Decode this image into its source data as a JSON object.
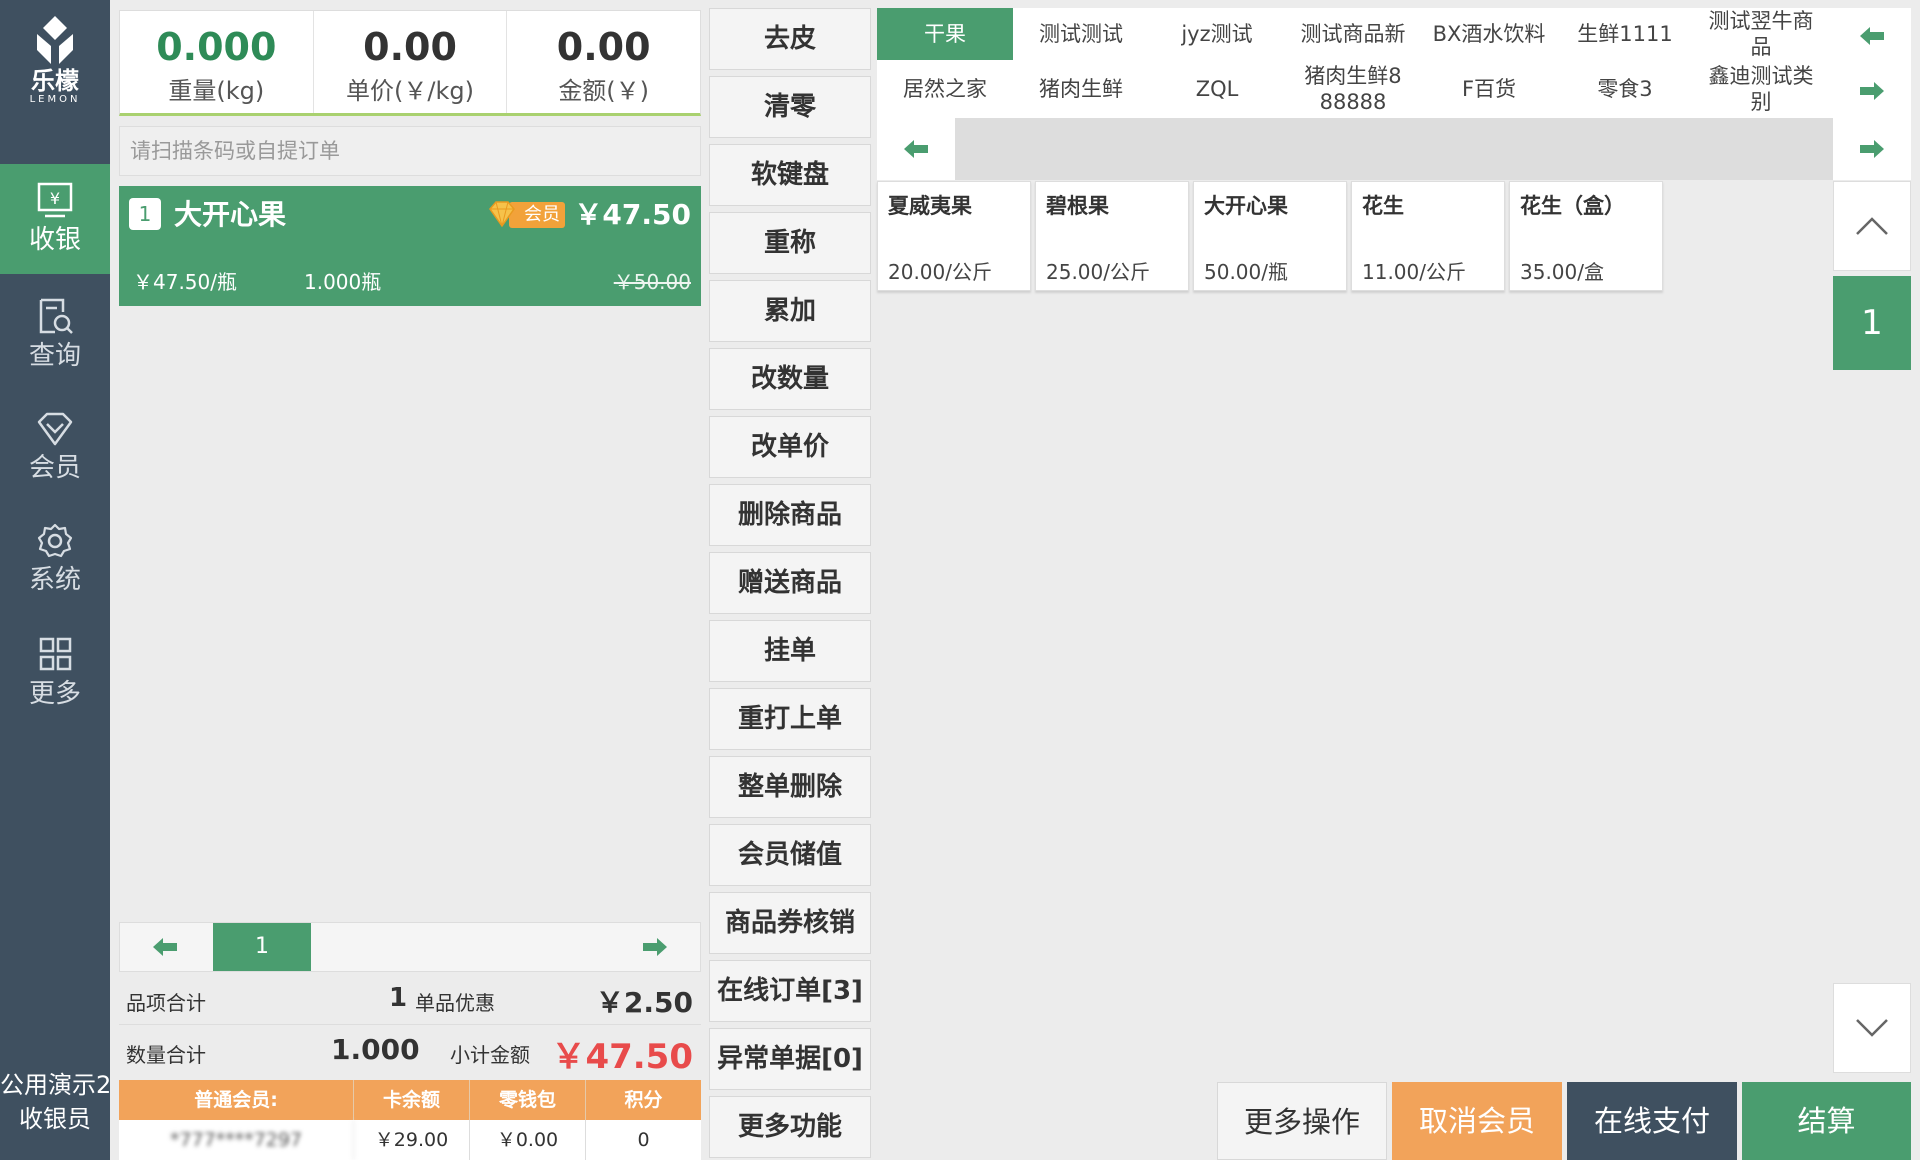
{
  "brand": {
    "name": "乐檬",
    "sub": "LEMON"
  },
  "nav": [
    {
      "label": "收银",
      "icon": "cashier-icon",
      "active": true
    },
    {
      "label": "查询",
      "icon": "query-icon"
    },
    {
      "label": "会员",
      "icon": "member-icon"
    },
    {
      "label": "系统",
      "icon": "gear-icon"
    },
    {
      "label": "更多",
      "icon": "grid-icon"
    }
  ],
  "cashier": {
    "line1": "公用演示2",
    "line2": "收银员"
  },
  "scale": {
    "weight": {
      "value": "0.000",
      "label": "重量(kg)"
    },
    "unit_price": {
      "value": "0.00",
      "label": "单价(￥/kg)"
    },
    "amount": {
      "value": "0.00",
      "label": "金额(￥)"
    }
  },
  "scan": {
    "placeholder": "请扫描条码或自提订单"
  },
  "order_items": [
    {
      "index": "1",
      "name": "大开心果",
      "badge": "会员",
      "total": "￥47.50",
      "unit_price": "￥47.50/瓶",
      "quantity": "1.000瓶",
      "original_price": "￥50.00"
    }
  ],
  "list_pager": {
    "current": "1"
  },
  "summary": {
    "items_label": "品项合计",
    "items_value": "1",
    "discount_label": "单品优惠",
    "discount_value": "￥2.50",
    "qty_label": "数量合计",
    "qty_value": "1.000",
    "subtotal_label": "小计金额",
    "subtotal_value": "￥47.50"
  },
  "member": {
    "headers": [
      "普通会员:",
      "卡余额",
      "零钱包",
      "积分"
    ],
    "values": [
      "*777****7297",
      "￥29.00",
      "￥0.00",
      "0"
    ]
  },
  "functions": [
    "去皮",
    "清零",
    "软键盘",
    "重称",
    "累加",
    "改数量",
    "改单价",
    "删除商品",
    "赠送商品",
    "挂单",
    "重打上单",
    "整单删除",
    "会员储值",
    "商品券核销",
    "在线订单[3]",
    "异常单据[0]",
    "更多功能"
  ],
  "categories": {
    "row1": [
      "干果",
      "测试测试",
      "jyz测试",
      "测试商品新",
      "BX酒水饮料",
      "生鲜1111",
      "测试翌牛商品"
    ],
    "row2": [
      "居然之家",
      "猪肉生鲜",
      "ZQL",
      "猪肉生鲜888888",
      "F百货",
      "零食3",
      "鑫迪测试类别"
    ],
    "active": "干果"
  },
  "products": [
    {
      "name": "夏威夷果",
      "price": "20.00/公斤"
    },
    {
      "name": "碧根果",
      "price": "25.00/公斤"
    },
    {
      "name": "大开心果",
      "price": "50.00/瓶"
    },
    {
      "name": "花生",
      "price": "11.00/公斤"
    },
    {
      "name": "花生（盒）",
      "price": "35.00/盒"
    }
  ],
  "product_page": "1",
  "actions": {
    "more": "更多操作",
    "cancel_member": "取消会员",
    "online_pay": "在线支付",
    "settle": "结算"
  },
  "colors": {
    "sidebar": "#3f5060",
    "accent_green": "#4a9d6f",
    "accent_orange": "#f2a35a",
    "price_red": "#e84b4b"
  }
}
